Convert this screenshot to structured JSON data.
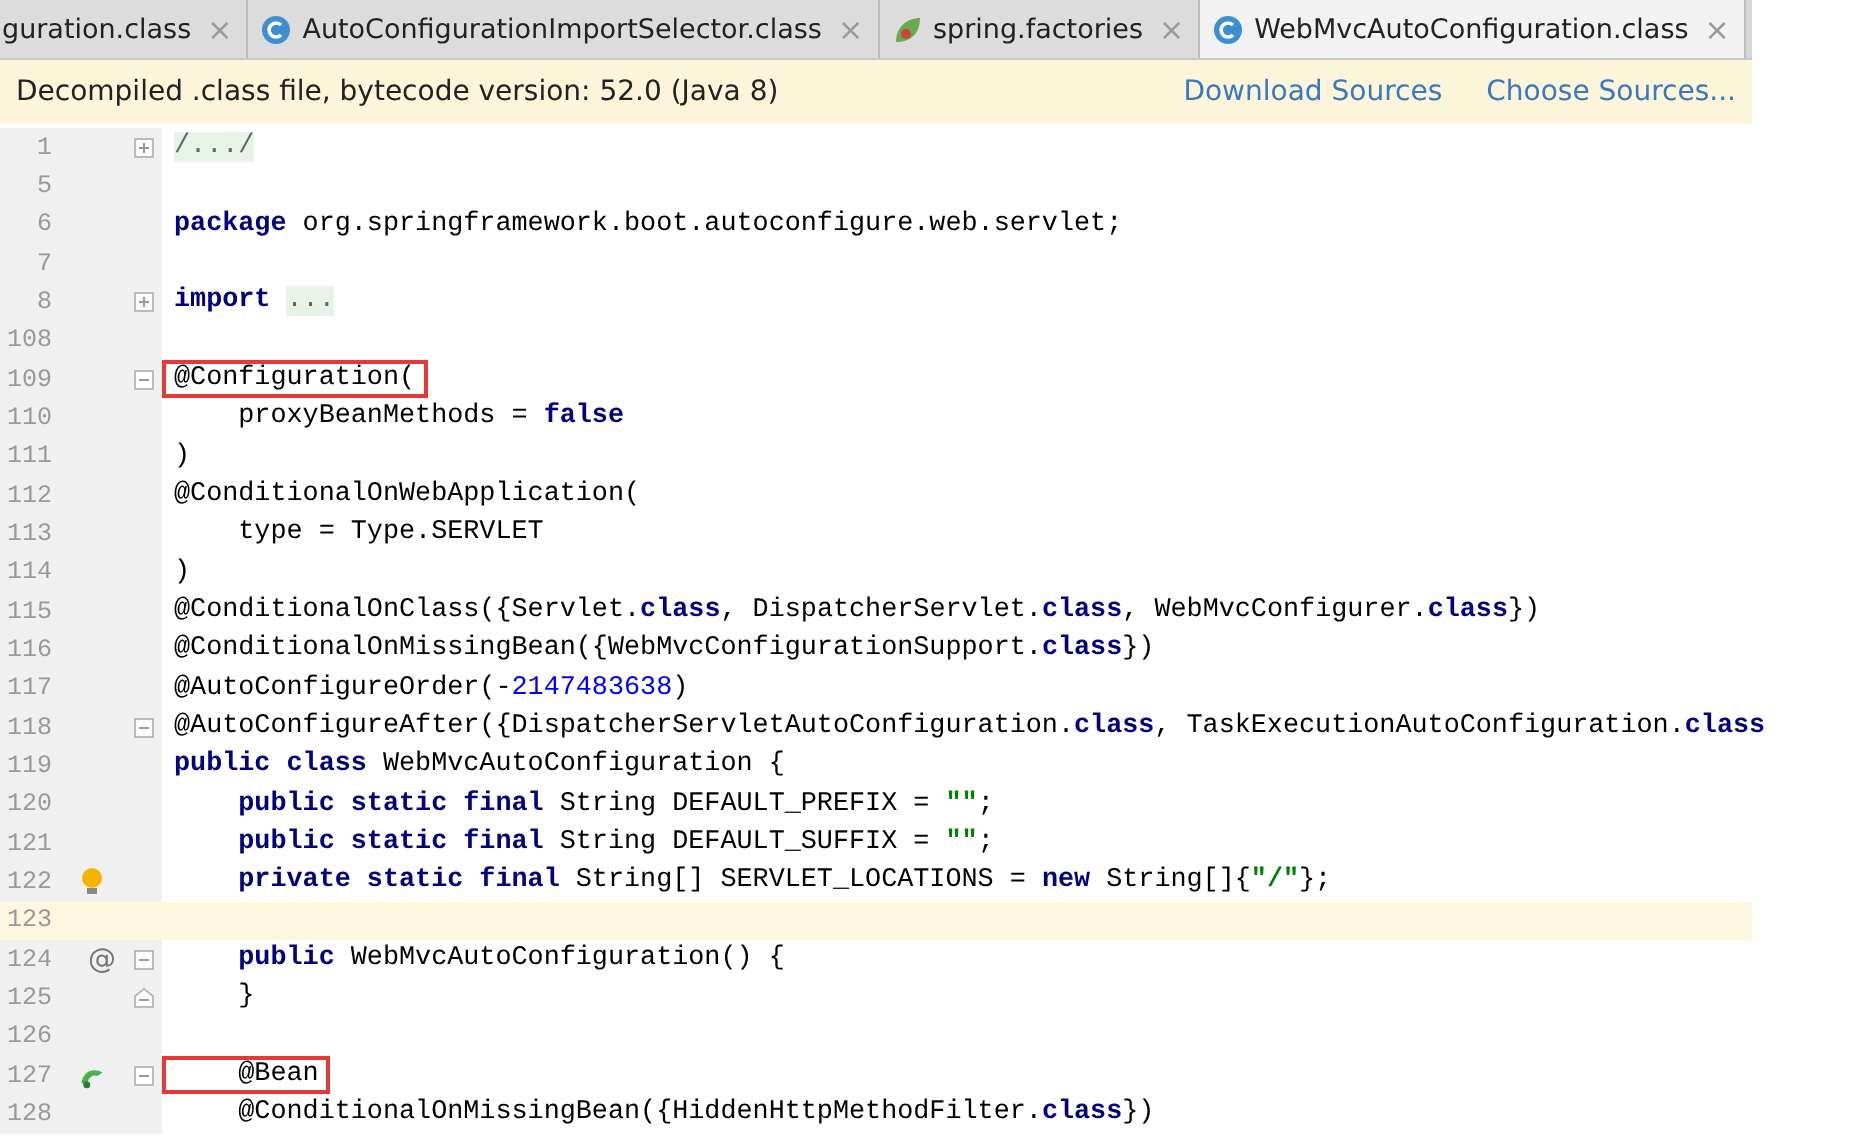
{
  "tabs": [
    {
      "label": "guration.class",
      "kind": "plain",
      "close": "×",
      "selected": false
    },
    {
      "label": "AutoConfigurationImportSelector.class",
      "kind": "class",
      "close": "×",
      "selected": false
    },
    {
      "label": "spring.factories",
      "kind": "factories",
      "close": "×",
      "selected": false
    },
    {
      "label": "WebMvcAutoConfiguration.class",
      "kind": "class",
      "close": "×",
      "selected": true
    }
  ],
  "banner": {
    "message": "Decompiled .class file, bytecode version: 52.0 (Java 8)",
    "links": [
      "Download Sources",
      "Choose Sources..."
    ]
  },
  "lines": [
    {
      "number": "1",
      "marks": [
        {
          "kind": "expand"
        }
      ],
      "tokens": [
        {
          "t": "/.../",
          "kind": "folded"
        }
      ]
    },
    {
      "number": "5"
    },
    {
      "number": "6",
      "tokens": [
        {
          "t": "package",
          "kind": "kw"
        },
        {
          "t": " org.springframework.boot.autoconfigure.web.servlet;",
          "kind": "plain"
        }
      ]
    },
    {
      "number": "7"
    },
    {
      "number": "8",
      "marks": [
        {
          "kind": "expand"
        }
      ],
      "tokens": [
        {
          "t": "import",
          "kind": "kw"
        },
        {
          "t": "...",
          "kind": "folded"
        }
      ]
    },
    {
      "number": "108"
    },
    {
      "number": "109",
      "marks": [
        {
          "kind": "collapse"
        }
      ],
      "tokens": [
        {
          "t": "@Configuration(",
          "kind": "plain",
          "boxed": true
        }
      ]
    },
    {
      "number": "110",
      "tokens": [
        {
          "t": "    proxyBeanMethods = ",
          "kind": "plain"
        },
        {
          "t": "false",
          "kind": "kw"
        }
      ]
    },
    {
      "number": "111",
      "tokens": [
        {
          "t": ")",
          "kind": "plain"
        }
      ]
    },
    {
      "number": "112",
      "tokens": [
        {
          "t": "@ConditionalOnWebApplication(",
          "kind": "plain"
        }
      ]
    },
    {
      "number": "113",
      "tokens": [
        {
          "t": "    type = Type.SERVLET",
          "kind": "plain"
        }
      ]
    },
    {
      "number": "114",
      "tokens": [
        {
          "t": ")",
          "kind": "plain"
        }
      ]
    },
    {
      "number": "115",
      "tokens": [
        {
          "t": "@ConditionalOnClass({Servlet.",
          "kind": "plain"
        },
        {
          "t": "class",
          "kind": "kw"
        },
        {
          "t": ", DispatcherServlet.",
          "kind": "plain"
        },
        {
          "t": "class",
          "kind": "kw"
        },
        {
          "t": ", WebMvcConfigurer.",
          "kind": "plain"
        },
        {
          "t": "class",
          "kind": "kw"
        },
        {
          "t": "})",
          "kind": "plain"
        }
      ]
    },
    {
      "number": "116",
      "tokens": [
        {
          "t": "@ConditionalOnMissingBean({WebMvcConfigurationSupport.",
          "kind": "plain"
        },
        {
          "t": "class",
          "kind": "kw"
        },
        {
          "t": "})",
          "kind": "plain"
        }
      ]
    },
    {
      "number": "117",
      "tokens": [
        {
          "t": "@AutoConfigureOrder(-",
          "kind": "plain"
        },
        {
          "t": "2147483638",
          "kind": "num"
        },
        {
          "t": ")",
          "kind": "plain"
        }
      ]
    },
    {
      "number": "118",
      "marks": [
        {
          "kind": "collapse"
        }
      ],
      "tokens": [
        {
          "t": "@AutoConfigureAfter({DispatcherServletAutoConfiguration.",
          "kind": "plain"
        },
        {
          "t": "class",
          "kind": "kw"
        },
        {
          "t": ", TaskExecutionAutoConfiguration.",
          "kind": "plain"
        },
        {
          "t": "class",
          "kind": "kw"
        }
      ]
    },
    {
      "number": "119",
      "tokens": [
        {
          "t": "public class",
          "kind": "kw"
        },
        {
          "t": " WebMvcAutoConfiguration {",
          "kind": "plain"
        }
      ]
    },
    {
      "number": "120",
      "tokens": [
        {
          "t": "    public static final",
          "kind": "kw"
        },
        {
          "t": " String DEFAULT_PREFIX = ",
          "kind": "plain"
        },
        {
          "t": "\"\"",
          "kind": "str"
        },
        {
          "t": ";",
          "kind": "plain"
        }
      ]
    },
    {
      "number": "121",
      "tokens": [
        {
          "t": "    public static final",
          "kind": "kw"
        },
        {
          "t": " String DEFAULT_SUFFIX = ",
          "kind": "plain"
        },
        {
          "t": "\"\"",
          "kind": "str"
        },
        {
          "t": ";",
          "kind": "plain"
        }
      ]
    },
    {
      "number": "122",
      "marks": [
        {
          "kind": "bulb"
        }
      ],
      "tokens": [
        {
          "t": "    private static final",
          "kind": "kw"
        },
        {
          "t": " String[] SERVLET_LOCATIONS = ",
          "kind": "plain"
        },
        {
          "t": "new",
          "kind": "kw"
        },
        {
          "t": " String[]{",
          "kind": "plain"
        },
        {
          "t": "\"/\"",
          "kind": "str"
        },
        {
          "t": "};",
          "kind": "plain"
        }
      ]
    },
    {
      "number": "123",
      "current": true
    },
    {
      "number": "124",
      "marks": [
        {
          "kind": "symbol",
          "text": "@"
        },
        {
          "kind": "collapse"
        }
      ],
      "tokens": [
        {
          "t": "    public",
          "kind": "kw"
        },
        {
          "t": " WebMvcAutoConfiguration() {",
          "kind": "plain"
        }
      ]
    },
    {
      "number": "125",
      "marks": [
        {
          "kind": "end"
        }
      ],
      "tokens": [
        {
          "t": "    }",
          "kind": "plain"
        }
      ]
    },
    {
      "number": "126"
    },
    {
      "number": "127",
      "marks": [
        {
          "kind": "bean"
        },
        {
          "kind": "collapse"
        }
      ],
      "tokens": [
        {
          "t": "    @Bean",
          "kind": "plain",
          "boxed": true
        }
      ]
    },
    {
      "number": "128",
      "tokens": [
        {
          "t": "    @ConditionalOnMissingBean({HiddenHttpMethodFilter.",
          "kind": "plain"
        },
        {
          "t": "class",
          "kind": "kw"
        },
        {
          "t": "})",
          "kind": "plain"
        }
      ]
    }
  ]
}
